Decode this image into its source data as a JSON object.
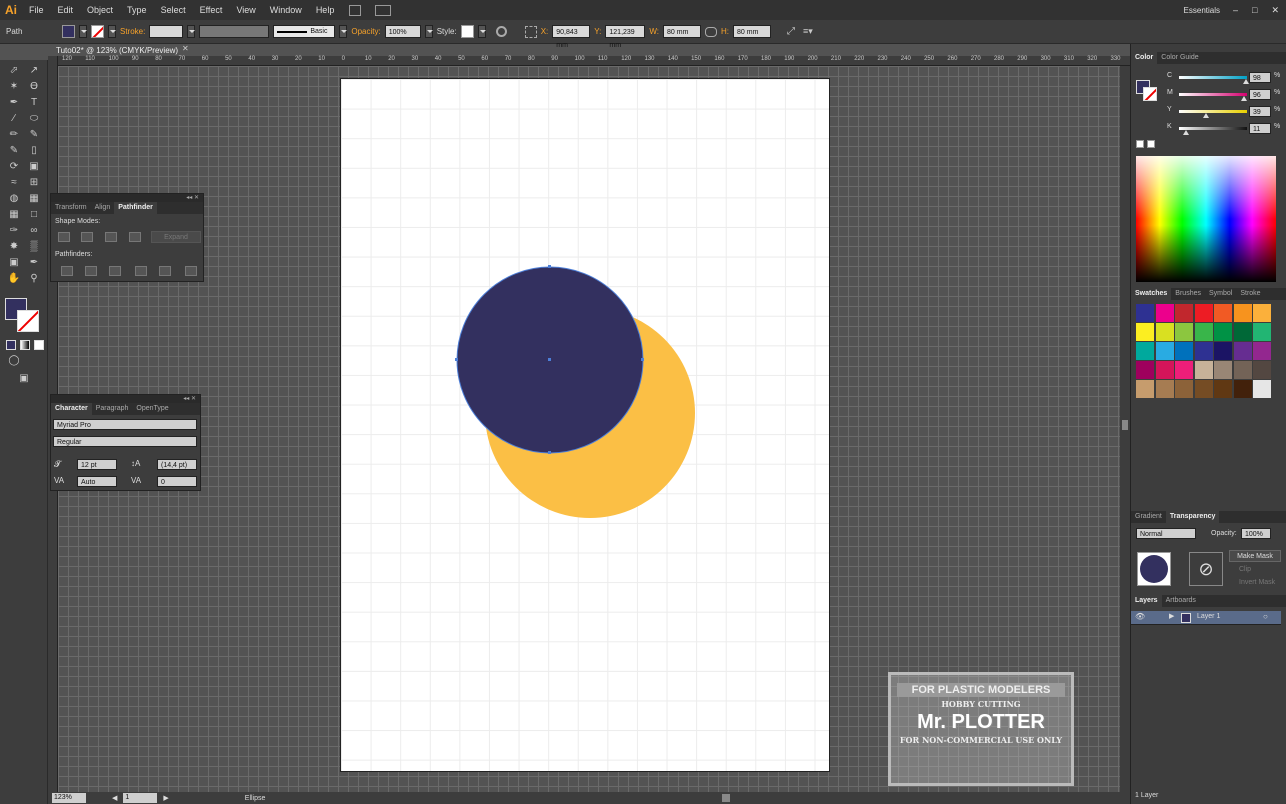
{
  "app": {
    "logo": "Ai",
    "workspace": "Essentials"
  },
  "menu": [
    "File",
    "Edit",
    "Object",
    "Type",
    "Select",
    "Effect",
    "View",
    "Window",
    "Help"
  ],
  "control_bar": {
    "selection_type": "Path",
    "stroke_label": "Stroke:",
    "stroke_profile": "Basic",
    "opacity_label": "Opacity:",
    "opacity_value": "100%",
    "style_label": "Style:",
    "x_label": "X:",
    "x_value": "90,843 mm",
    "y_label": "Y:",
    "y_value": "121,239 mm",
    "w_label": "W:",
    "w_value": "80 mm",
    "h_label": "H:",
    "h_value": "80 mm"
  },
  "document_tab": "Tuto02* @ 123% (CMYK/Preview)",
  "ruler_top": [
    "120",
    "110",
    "100",
    "90",
    "80",
    "70",
    "60",
    "50",
    "40",
    "30",
    "20",
    "10",
    "0",
    "10",
    "20",
    "30",
    "40",
    "50",
    "60",
    "70",
    "80",
    "90",
    "100",
    "110",
    "120",
    "130",
    "140",
    "150",
    "160",
    "170",
    "180",
    "190",
    "200",
    "210",
    "220",
    "230",
    "240",
    "250",
    "260",
    "270",
    "280",
    "290",
    "300",
    "310",
    "320",
    "330"
  ],
  "pathfinder_panel": {
    "tabs": [
      "Transform",
      "Align",
      "Pathfinder"
    ],
    "shape_modes_label": "Shape Modes:",
    "expand_label": "Expand",
    "pathfinders_label": "Pathfinders:"
  },
  "character_panel": {
    "tabs": [
      "Character",
      "Paragraph",
      "OpenType"
    ],
    "font_family": "Myriad Pro",
    "font_style": "Regular",
    "font_size": "12 pt",
    "leading": "(14,4 pt)",
    "kerning": "Auto",
    "tracking": "0"
  },
  "color_panel": {
    "tabs": [
      "Color",
      "Color Guide"
    ],
    "channels": [
      {
        "label": "C",
        "value": "98",
        "pct": "%",
        "color": "#00a0c6"
      },
      {
        "label": "M",
        "value": "96",
        "pct": "%",
        "color": "#d4006f"
      },
      {
        "label": "Y",
        "value": "39",
        "pct": "%",
        "color": "#e8d000"
      },
      {
        "label": "K",
        "value": "11",
        "pct": "%",
        "color": "#111111"
      }
    ],
    "levels": [
      0.98,
      0.96,
      0.39,
      0.11
    ]
  },
  "swatches_panel": {
    "tabs": [
      "Swatches",
      "Brushes",
      "Symbol",
      "Stroke"
    ],
    "colors": [
      "#2e3192",
      "#ec008c",
      "#c1272d",
      "#ed1c24",
      "#f15a24",
      "#f7931e",
      "#fbb03b",
      "#fcee21",
      "#d9e021",
      "#8cc63f",
      "#39b54a",
      "#009245",
      "#006837",
      "#22b573",
      "#00a99d",
      "#29abe2",
      "#0071bc",
      "#2e3192",
      "#1b1464",
      "#662d91",
      "#93278f",
      "#9e005d",
      "#d4145a",
      "#ed1e79",
      "#c7b299",
      "#998675",
      "#736357",
      "#534741",
      "#c69c6d",
      "#a67c52",
      "#8c6239",
      "#754c24",
      "#603813",
      "#42210b",
      "#e6e6e6"
    ]
  },
  "transparency_panel": {
    "tabs": [
      "Gradient",
      "Transparency"
    ],
    "blend_mode": "Normal",
    "opacity_label": "Opacity:",
    "opacity_value": "100%",
    "make_mask": "Make Mask",
    "clip": "Clip",
    "invert_mask": "Invert Mask"
  },
  "layers_panel": {
    "tabs": [
      "Layers",
      "Artboards"
    ],
    "layer_name": "Layer 1",
    "footer": "1 Layer"
  },
  "status_bar": {
    "zoom": "123%",
    "artboard": "1",
    "tool": "Ellipse"
  },
  "artwork": {
    "front_circle_color": "#33305f",
    "back_circle_color": "#fbbf45"
  },
  "watermark": {
    "line1": "FOR PLASTIC MODELERS",
    "line2": "HOBBY CUTTING",
    "line3": "Mr. PLOTTER",
    "line4": "FOR NON-COMMERCIAL USE ONLY"
  }
}
